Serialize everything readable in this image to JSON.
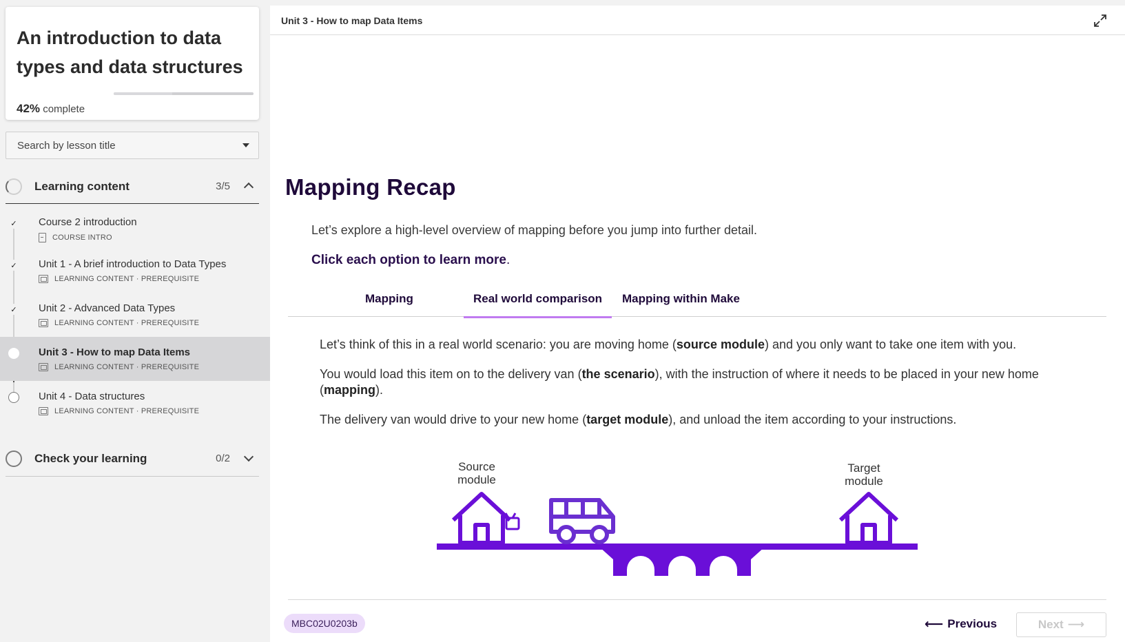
{
  "course": {
    "title": "An introduction to data types and data structures",
    "progress_percent": 42,
    "progress_value": "42%",
    "progress_suffix": " complete"
  },
  "search": {
    "placeholder": "Search by lesson title"
  },
  "sections": [
    {
      "title": "Learning content",
      "count": "3/5",
      "expanded": true,
      "lessons": [
        {
          "title": "Course 2 introduction",
          "meta": "COURSE INTRO",
          "status": "done",
          "icon": "document-icon"
        },
        {
          "title": "Unit 1 - A brief introduction to Data Types",
          "meta": "LEARNING CONTENT · PREREQUISITE",
          "status": "done",
          "icon": "slides-icon"
        },
        {
          "title": "Unit 2 - Advanced Data Types",
          "meta": "LEARNING CONTENT · PREREQUISITE",
          "status": "done",
          "icon": "slides-icon"
        },
        {
          "title": "Unit 3 - How to map Data Items",
          "meta": "LEARNING CONTENT · PREREQUISITE",
          "status": "current",
          "icon": "slides-icon"
        },
        {
          "title": "Unit 4 - Data structures",
          "meta": "LEARNING CONTENT · PREREQUISITE",
          "status": "todo",
          "icon": "slides-icon"
        }
      ]
    },
    {
      "title": "Check your learning",
      "count": "0/2",
      "expanded": false
    }
  ],
  "main": {
    "topbar_title": "Unit 3 - How to map Data Items",
    "heading": "Mapping Recap",
    "intro": "Let’s explore a high-level overview of mapping before you jump into further detail.",
    "click_prompt_bold": "Click each option to learn more",
    "click_prompt_end": ".",
    "tabs": [
      {
        "label": "Mapping",
        "active": false
      },
      {
        "label": "Real world comparison",
        "active": true
      },
      {
        "label": "Mapping within Make",
        "active": false
      }
    ],
    "paragraphs": [
      [
        "Let’s think of this in a real world scenario: you are moving home (",
        "source module",
        ") and you only want to take one item with you."
      ],
      [
        "You would load this item on to the delivery van (",
        "the scenario",
        "), with the instruction of where it needs to be placed in your new home (",
        "mapping",
        ")."
      ],
      [
        "The delivery van would drive to your new home (",
        "target module",
        "), and unload the item according to your instructions."
      ]
    ],
    "illustration": {
      "source_label_line1": "Source",
      "source_label_line2": "module",
      "target_label_line1": "Target",
      "target_label_line2": "module",
      "color": "#6a0fd8"
    },
    "badge": "MBC02U0203b",
    "prev_label": "Previous",
    "next_label": "Next"
  },
  "colors": {
    "accent": "#6a0fd8",
    "tab_underline": "#c07bf0",
    "heading": "#1f0a3a",
    "badge_bg": "#ecdcfa"
  }
}
